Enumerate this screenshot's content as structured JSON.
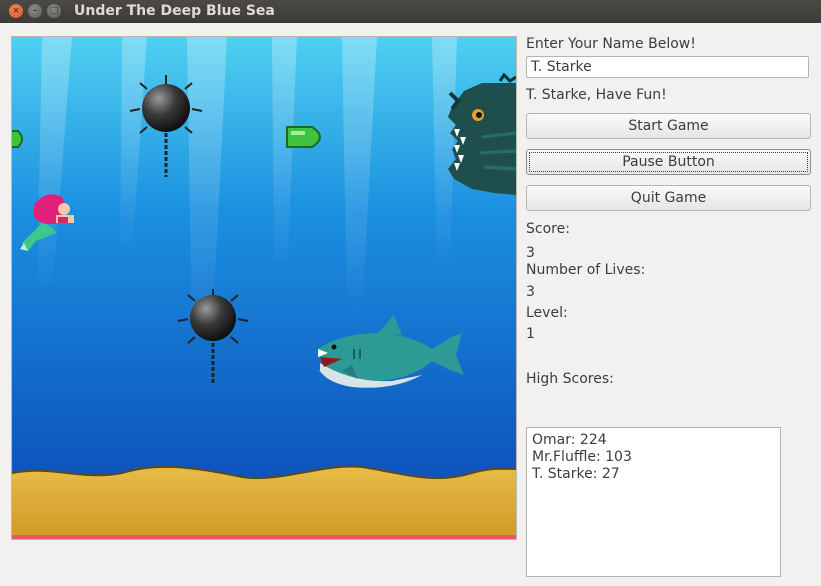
{
  "window": {
    "title": "Under The Deep Blue Sea",
    "controls": {
      "close": "×",
      "minimize": "–",
      "maximize": "□"
    }
  },
  "panel": {
    "name_prompt": "Enter Your Name Below!",
    "name_value": "T. Starke",
    "greeting": "T. Starke, Have Fun!",
    "start_button": "Start Game",
    "pause_button": "Pause Button",
    "quit_button": "Quit Game",
    "score_label": "Score:",
    "score_value": "3",
    "lives_label": "Number of Lives:",
    "lives_value": "3",
    "level_label": "Level:",
    "level_value": "1",
    "high_scores_label": "High Scores:",
    "high_scores": [
      "Omar: 224",
      "Mr.Fluffle: 103",
      "T. Starke: 27"
    ]
  },
  "game": {
    "sprites": [
      "mermaid-player",
      "sea-mine",
      "sea-mine",
      "green-bullet",
      "green-bullet",
      "shark-enemy",
      "anglerfish-enemy"
    ],
    "colors": {
      "water_top": "#4fd0f0",
      "water_bottom": "#0a46b4",
      "sand": "#e2b33c"
    }
  }
}
